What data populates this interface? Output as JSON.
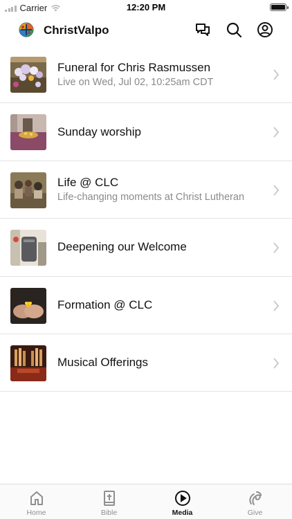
{
  "status_bar": {
    "carrier": "Carrier",
    "time": "12:20 PM"
  },
  "header": {
    "title": "ChristValpo",
    "icons": [
      "chat-icon",
      "search-icon",
      "account-icon"
    ]
  },
  "media_list": [
    {
      "title": "Funeral for Chris Rasmussen",
      "subtitle": "Live on Wed, Jul 02, 10:25am CDT",
      "thumbnail": "flowers-thumbnail"
    },
    {
      "title": "Sunday worship",
      "subtitle": "",
      "thumbnail": "worship-thumbnail"
    },
    {
      "title": "Life @ CLC",
      "subtitle": "Life-changing moments at Christ Lutheran",
      "thumbnail": "children-thumbnail"
    },
    {
      "title": "Deepening our Welcome",
      "subtitle": "",
      "thumbnail": "welcome-thumbnail"
    },
    {
      "title": "Formation @ CLC",
      "subtitle": "",
      "thumbnail": "hands-thumbnail"
    },
    {
      "title": "Musical Offerings",
      "subtitle": "",
      "thumbnail": "organ-thumbnail"
    }
  ],
  "tab_bar": {
    "active": "Media",
    "tabs": [
      {
        "label": "Home",
        "icon": "home-icon"
      },
      {
        "label": "Bible",
        "icon": "bible-icon"
      },
      {
        "label": "Media",
        "icon": "play-circle-icon"
      },
      {
        "label": "Give",
        "icon": "give-icon"
      }
    ]
  },
  "colors": {
    "text": "#111111",
    "subtitle": "#8a8a8a",
    "separator": "#e3e3e3",
    "tab_inactive": "#8e8e8e",
    "chevron": "#c7c7cc"
  }
}
